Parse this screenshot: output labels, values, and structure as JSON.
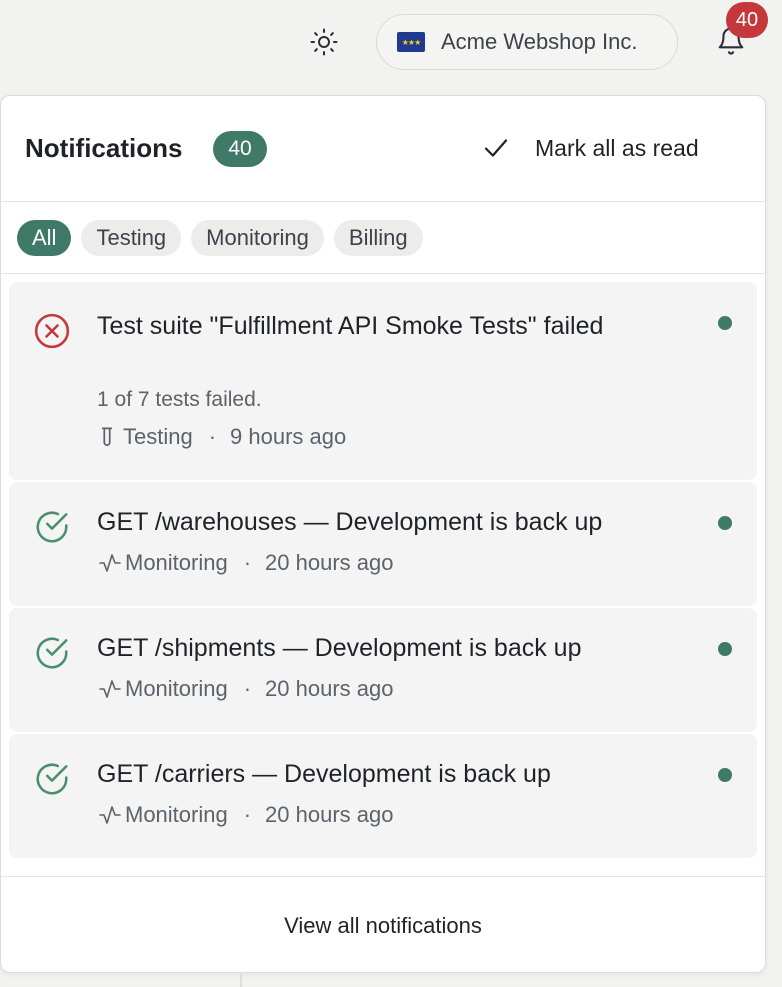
{
  "topbar": {
    "theme_icon": "sun-icon",
    "org": {
      "name": "Acme Webshop Inc.",
      "flag_icon": "eu-flag-icon"
    },
    "bell_icon": "bell-icon",
    "bell_badge": "40"
  },
  "panel": {
    "title": "Notifications",
    "count": "40",
    "mark_all_label": "Mark all as read",
    "filters": [
      "All",
      "Testing",
      "Monitoring",
      "Billing"
    ],
    "active_filter": "All",
    "notifications": [
      {
        "status": "failed",
        "status_icon": "error-circle-icon",
        "title": "Test suite \"Fulfillment API Smoke Tests\" failed",
        "description": "1 of 7 tests failed.",
        "category": "Testing",
        "category_icon": "test-tube-icon",
        "time": "9 hours ago",
        "unread": true
      },
      {
        "status": "ok",
        "status_icon": "check-circle-icon",
        "title": "GET /warehouses — Development is back up",
        "description": "",
        "category": "Monitoring",
        "category_icon": "activity-icon",
        "time": "20 hours ago",
        "unread": true
      },
      {
        "status": "ok",
        "status_icon": "check-circle-icon",
        "title": "GET /shipments — Development is back up",
        "description": "",
        "category": "Monitoring",
        "category_icon": "activity-icon",
        "time": "20 hours ago",
        "unread": true
      },
      {
        "status": "ok",
        "status_icon": "check-circle-icon",
        "title": "GET /carriers — Development is back up",
        "description": "",
        "category": "Monitoring",
        "category_icon": "activity-icon",
        "time": "20 hours ago",
        "unread": true
      }
    ],
    "footer_link": "View all notifications"
  },
  "colors": {
    "accent": "#3f7a68",
    "error": "#c4373a",
    "success": "#4a8f6e",
    "item_bg": "#f3f4f3"
  }
}
